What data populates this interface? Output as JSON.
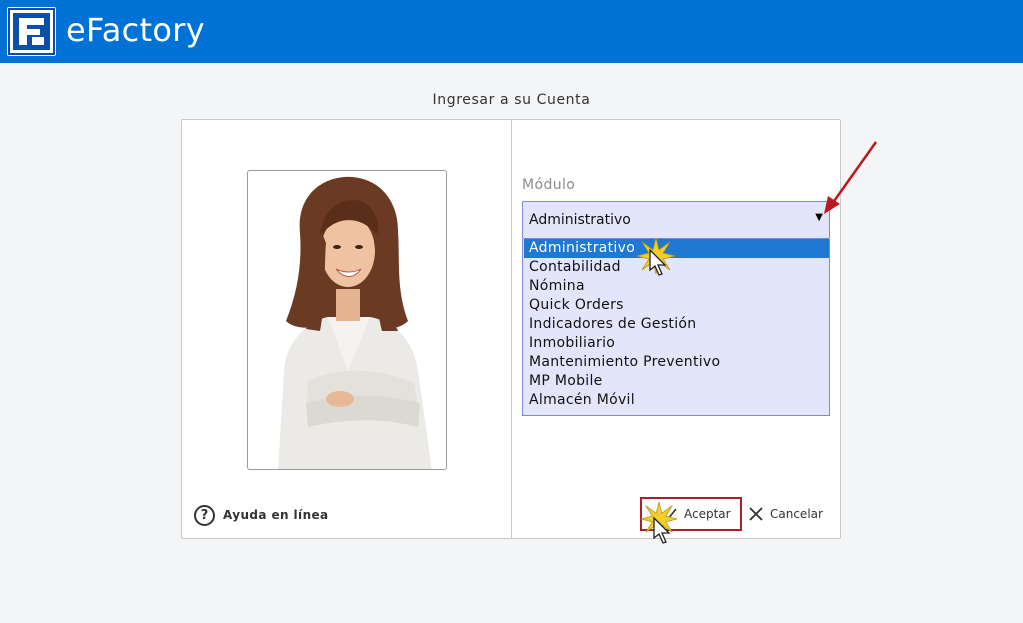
{
  "header": {
    "app_name": "eFactory",
    "brand_color": "#0072d6"
  },
  "login": {
    "title": "Ingresar a su Cuenta"
  },
  "help": {
    "icon": "question-circle-icon",
    "label": "Ayuda en línea"
  },
  "module": {
    "label": "Módulo",
    "selected": "Administrativo",
    "options": [
      "Administrativo",
      "Contabilidad",
      "Nómina",
      "Quick Orders",
      "Indicadores de Gestión",
      "Inmobiliario",
      "Mantenimiento Preventivo",
      "MP Mobile",
      "Almacén Móvil"
    ]
  },
  "actions": {
    "accept_label": "Aceptar",
    "cancel_label": "Cancelar"
  },
  "colors": {
    "accent": "#0072d6",
    "dropdown_bg": "#e3e6fb",
    "selected_option": "#1f78d1",
    "highlight_border": "#a8202a"
  }
}
